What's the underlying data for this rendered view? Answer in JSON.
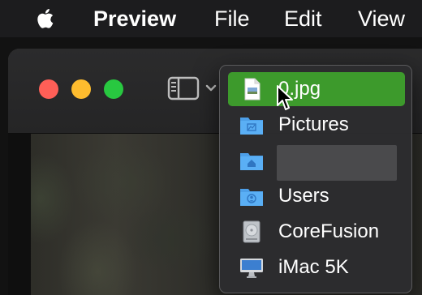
{
  "menubar": {
    "apple_icon": "apple-logo-icon",
    "app_name": "Preview",
    "items": [
      "File",
      "Edit",
      "View"
    ]
  },
  "window": {
    "traffic_lights": [
      "close",
      "minimize",
      "zoom"
    ],
    "toolbar": {
      "sidebar_icon": "sidebar-toggle-icon",
      "chevron_icon": "chevron-down-icon"
    }
  },
  "popup": {
    "items": [
      {
        "label": "0.jpg",
        "icon": "jpg-document-icon",
        "selected": true
      },
      {
        "label": "Pictures",
        "icon": "pictures-folder-icon"
      },
      {
        "label": "",
        "icon": "home-folder-icon",
        "redacted": true
      },
      {
        "label": "Users",
        "icon": "users-folder-icon"
      },
      {
        "label": "CoreFusion",
        "icon": "hard-drive-icon"
      },
      {
        "label": "iMac 5K",
        "icon": "imac-icon"
      }
    ]
  },
  "colors": {
    "selection": "#3d9a2c",
    "folder": "#5aaff5",
    "close": "#ff5f57",
    "minimize": "#febc2e",
    "zoom": "#28c840"
  }
}
